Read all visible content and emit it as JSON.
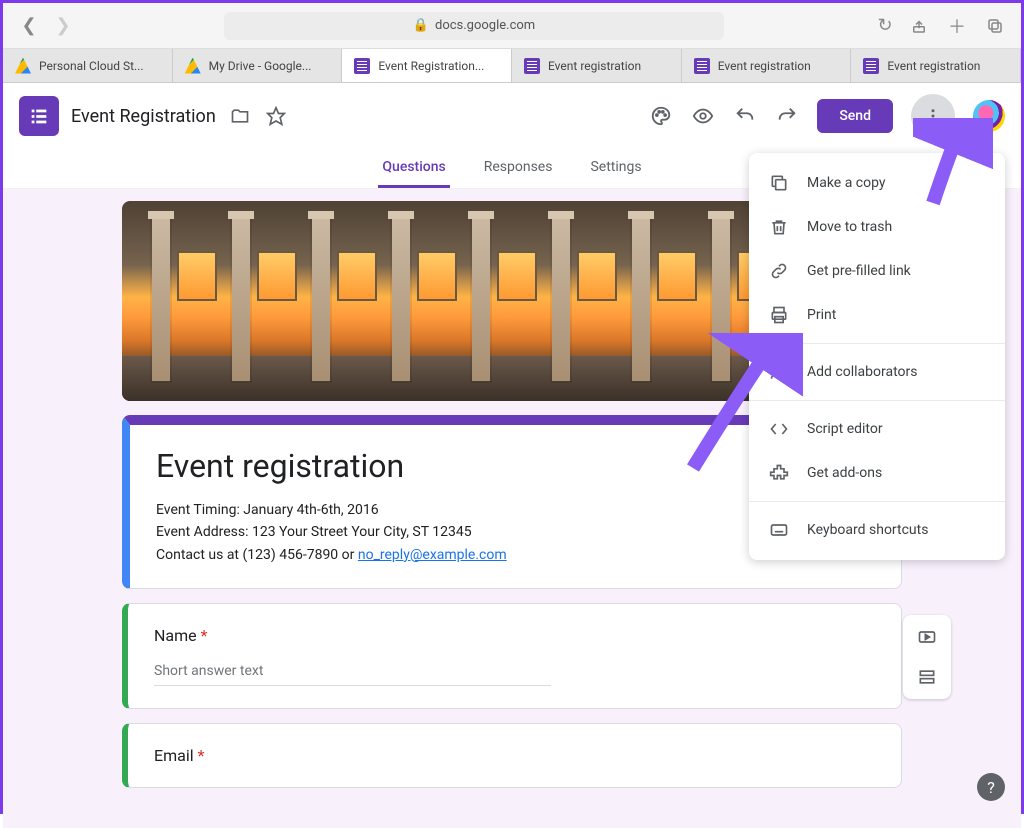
{
  "browser": {
    "url_host": "docs.google.com",
    "tabs": [
      {
        "label": "Personal Cloud St...",
        "icon": "drive"
      },
      {
        "label": "My Drive - Google...",
        "icon": "drive"
      },
      {
        "label": "Event Registration...",
        "icon": "forms",
        "active": true
      },
      {
        "label": "Event registration",
        "icon": "forms"
      },
      {
        "label": "Event registration",
        "icon": "forms"
      },
      {
        "label": "Event registration",
        "icon": "forms"
      }
    ]
  },
  "header": {
    "doc_title": "Event Registration",
    "send_label": "Send"
  },
  "nav_tabs": {
    "questions": "Questions",
    "responses": "Responses",
    "settings": "Settings"
  },
  "form": {
    "title": "Event registration",
    "desc_line1": "Event Timing: January 4th-6th, 2016",
    "desc_line2": "Event Address: 123 Your Street Your City, ST 12345",
    "desc_line3a": "Contact us at (123) 456-7890 or ",
    "desc_email": "no_reply@example.com",
    "q1_label": "Name",
    "q2_label": "Email",
    "short_answer_placeholder": "Short answer text"
  },
  "menu": {
    "copy": "Make a copy",
    "trash": "Move to trash",
    "prefill": "Get pre-filled link",
    "print": "Print",
    "collab": "Add collaborators",
    "script": "Script editor",
    "addons": "Get add-ons",
    "shortcuts": "Keyboard shortcuts"
  }
}
